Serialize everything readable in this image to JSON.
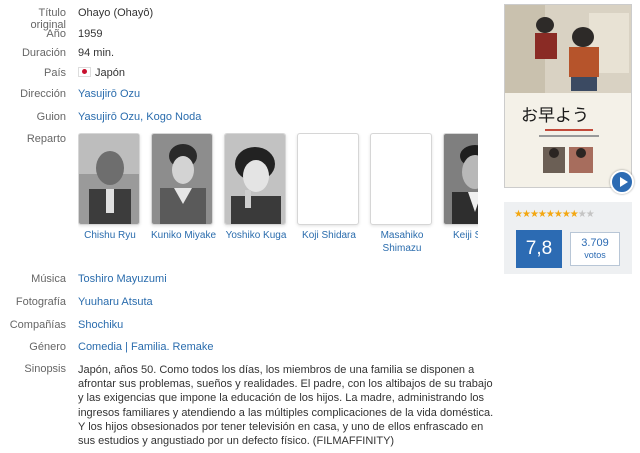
{
  "film": {
    "original_title_label": "Título original",
    "original_title": "Ohayo (Ohayô)",
    "year_label": "Año",
    "year": "1959",
    "duration_label": "Duración",
    "duration": "94 min.",
    "country_label": "País",
    "country": "Japón",
    "country_flag_icon": "japan-flag-icon",
    "director_label": "Dirección",
    "director": "Yasujirō Ozu",
    "screenplay_label": "Guion",
    "screenplay": "Yasujirō Ozu, Kogo Noda",
    "cast_label": "Reparto",
    "cast": [
      {
        "name": "Chishu Ryu"
      },
      {
        "name": "Kuniko Miyake"
      },
      {
        "name": "Yoshiko Kuga"
      },
      {
        "name": "Koji Shidara"
      },
      {
        "name": "Masahiko\nShimazu"
      },
      {
        "name": "Keiji S"
      }
    ],
    "music_label": "Música",
    "music": "Toshiro Mayuzumi",
    "photography_label": "Fotografía",
    "photography": "Yuuharu Atsuta",
    "companies_label": "Compañías",
    "companies": "Shochiku",
    "genre_label": "Género",
    "genre": "Comedia | Familia. Remake",
    "synopsis_label": "Sinopsis",
    "synopsis": "Japón, años 50. Como todos los días, los miembros de una familia se disponen a afrontar sus problemas, sueños y realidades. El padre, con los altibajos de su trabajo y las exigencias que impone la educación de los hijos. La madre, administrando los ingresos familiares y atendiendo a las múltiples complicaciones de la vida doméstica. Y los hijos obsesionados por tener televisión en casa, y uno de ellos enfrascado en sus estudios y angustiado por un defecto físico. (FILMAFFINITY)"
  },
  "poster": {
    "title_glyphs": "お早よう"
  },
  "rating": {
    "average": "7,8",
    "stars_filled": 8,
    "stars_total": 10,
    "votes_count": "3.709",
    "votes_label": "votos"
  },
  "colors": {
    "link": "#2a6cad",
    "rating_blue": "#2c6bb3",
    "star": "#f3a712"
  }
}
